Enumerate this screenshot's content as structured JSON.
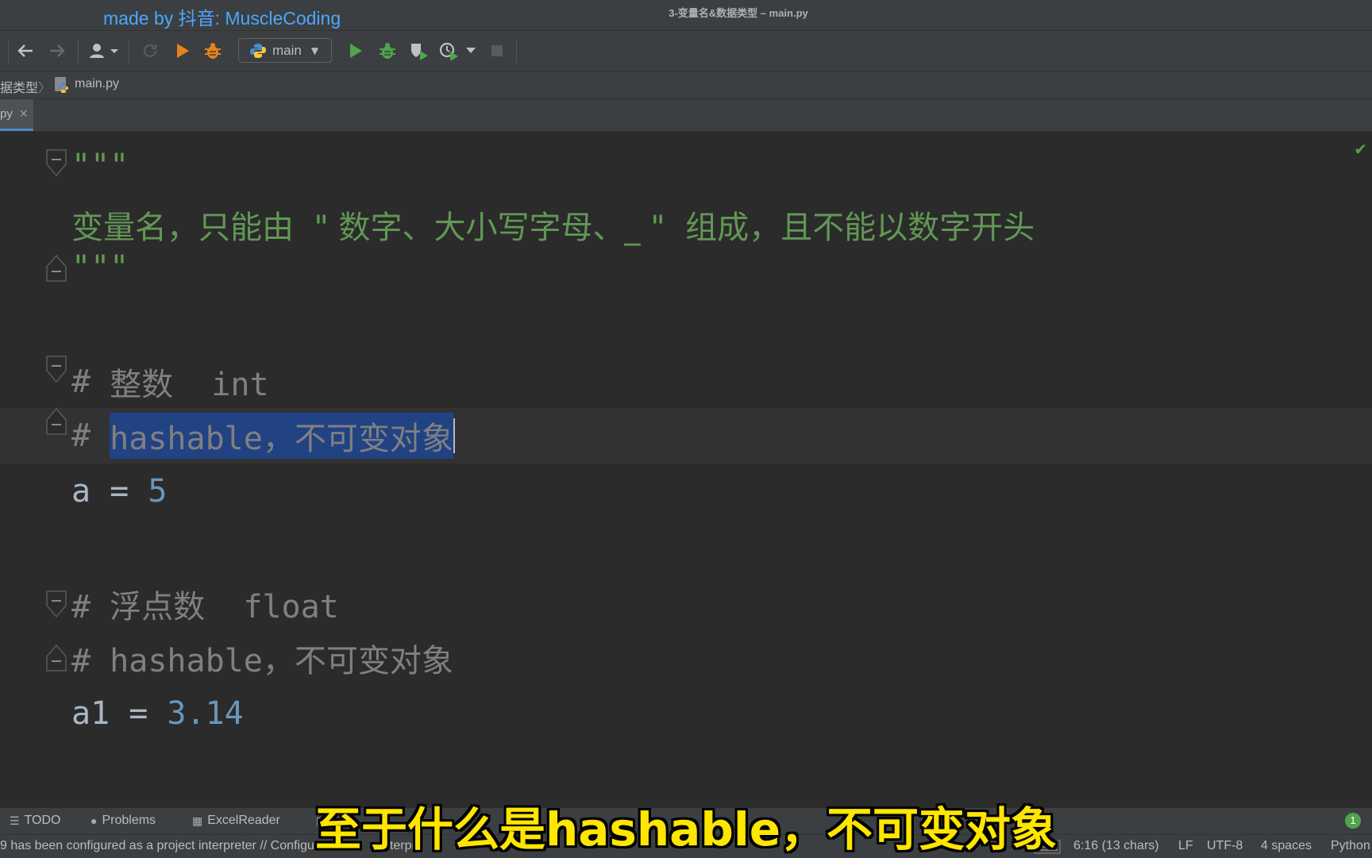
{
  "watermark": "made by 抖音: MuscleCoding",
  "window_title": "3-变量名&数据类型 – main.py",
  "toolbar": {
    "run_config": "main",
    "icons": [
      "back-arrow-icon",
      "forward-arrow-icon",
      "user-icon",
      "refresh-icon",
      "build-hammer-icon",
      "debug-bug-icon",
      "python-icon",
      "run-icon",
      "debug-icon",
      "coverage-icon",
      "profile-icon",
      "stop-icon"
    ]
  },
  "breadcrumb": {
    "folder": "据类型",
    "file": "main.py"
  },
  "tab": {
    "label": "py"
  },
  "editor": {
    "lines": {
      "l1": "\"\"\"",
      "l2": "变量名，只能由  \" 数字、大小写字母、_ \"  组成，且不能以数字开头",
      "l3": "\"\"\"",
      "l4_hash": "# ",
      "l4_text": "整数  int",
      "l5_hash": "# ",
      "l5_sel": "hashable，不可变对象",
      "l6_id": "a = ",
      "l6_num": "5",
      "l7": "# 浮点数  float",
      "l8": "# hashable，不可变对象",
      "l9_id": "a1 = ",
      "l9_num": "3.14"
    },
    "colors": {
      "docstring": "#629755",
      "comment": "#808080",
      "identifier": "#a9b7c6",
      "number": "#6897bb",
      "selection": "#214283"
    }
  },
  "bottom_tools": {
    "todo": "TODO",
    "problems": "Problems",
    "excelreader": "ExcelReader",
    "terminal": "T",
    "right_badge": "1"
  },
  "status": {
    "message": "9 has been configured as a project interpreter // Configu",
    "message_tail": "nterpre",
    "position": "6:16 (13 chars)",
    "line_ending": "LF",
    "encoding": "UTF-8",
    "indent": "4 spaces",
    "interpreter": "Python"
  },
  "subtitle": "至于什么是hashable，不可变对象"
}
